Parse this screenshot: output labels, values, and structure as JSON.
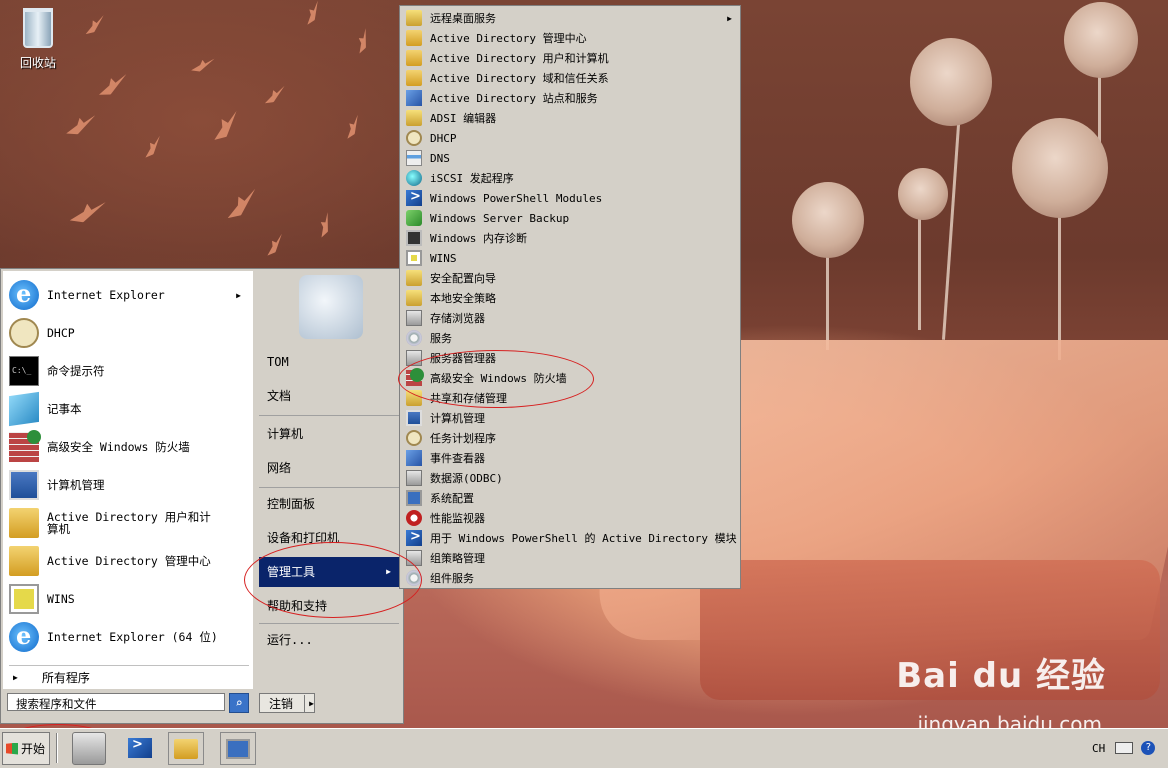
{
  "desktop": {
    "recycle_bin_label": "回收站",
    "watermark_brand": "Bai du 经验",
    "watermark_url": "jingyan.baidu.com"
  },
  "start_menu": {
    "pinned": [
      {
        "label": "Internet Explorer",
        "icon": "internet-explorer-icon",
        "has_submenu": true
      },
      {
        "label": "DHCP",
        "icon": "dhcp-icon",
        "has_submenu": false
      },
      {
        "label": "命令提示符",
        "icon": "command-prompt-icon",
        "has_submenu": false
      },
      {
        "label": "记事本",
        "icon": "notepad-icon",
        "has_submenu": false
      },
      {
        "label": "高级安全 Windows 防火墙",
        "icon": "firewall-icon",
        "has_submenu": false
      },
      {
        "label": "计算机管理",
        "icon": "computer-management-icon",
        "has_submenu": false
      },
      {
        "label": "Active Directory 用户和计算机",
        "icon": "ad-users-computers-icon",
        "has_submenu": false
      },
      {
        "label": "Active Directory 管理中心",
        "icon": "ad-admin-center-icon",
        "has_submenu": false
      },
      {
        "label": "WINS",
        "icon": "wins-icon",
        "has_submenu": false
      },
      {
        "label": "Internet Explorer (64 位)",
        "icon": "internet-explorer-icon",
        "has_submenu": false
      }
    ],
    "all_programs": "所有程序",
    "search_placeholder": "搜索程序和文件",
    "right_pane": {
      "user": "TOM",
      "documents": "文档",
      "computer": "计算机",
      "network": "网络",
      "control_panel": "控制面板",
      "devices_printers": "设备和打印机",
      "admin_tools": "管理工具",
      "help": "帮助和支持",
      "run": "运行..."
    },
    "logoff": "注销"
  },
  "admin_tools_submenu": [
    {
      "label": "远程桌面服务",
      "icon": "folder-icon",
      "has_submenu": true
    },
    {
      "label": "Active Directory 管理中心",
      "icon": "ad-admin-center-icon"
    },
    {
      "label": "Active Directory 用户和计算机",
      "icon": "ad-users-computers-icon"
    },
    {
      "label": "Active Directory 域和信任关系",
      "icon": "ad-domains-trusts-icon"
    },
    {
      "label": "Active Directory 站点和服务",
      "icon": "ad-sites-services-icon"
    },
    {
      "label": "ADSI 编辑器",
      "icon": "adsi-edit-icon"
    },
    {
      "label": "DHCP",
      "icon": "dhcp-icon"
    },
    {
      "label": "DNS",
      "icon": "dns-icon"
    },
    {
      "label": "iSCSI 发起程序",
      "icon": "iscsi-icon"
    },
    {
      "label": "Windows PowerShell Modules",
      "icon": "powershell-icon"
    },
    {
      "label": "Windows Server Backup",
      "icon": "backup-icon"
    },
    {
      "label": "Windows 内存诊断",
      "icon": "memory-diagnostic-icon"
    },
    {
      "label": "WINS",
      "icon": "wins-icon"
    },
    {
      "label": "安全配置向导",
      "icon": "security-wizard-icon"
    },
    {
      "label": "本地安全策略",
      "icon": "local-security-policy-icon"
    },
    {
      "label": "存储浏览器",
      "icon": "storage-explorer-icon"
    },
    {
      "label": "服务",
      "icon": "services-icon"
    },
    {
      "label": "服务器管理器",
      "icon": "server-manager-icon"
    },
    {
      "label": "高级安全 Windows 防火墙",
      "icon": "firewall-icon"
    },
    {
      "label": "共享和存储管理",
      "icon": "share-storage-icon"
    },
    {
      "label": "计算机管理",
      "icon": "computer-management-icon"
    },
    {
      "label": "任务计划程序",
      "icon": "task-scheduler-icon"
    },
    {
      "label": "事件查看器",
      "icon": "event-viewer-icon"
    },
    {
      "label": "数据源(ODBC)",
      "icon": "odbc-icon"
    },
    {
      "label": "系统配置",
      "icon": "system-config-icon"
    },
    {
      "label": "性能监视器",
      "icon": "performance-monitor-icon"
    },
    {
      "label": "用于 Windows PowerShell 的 Active Directory 模块",
      "icon": "powershell-icon"
    },
    {
      "label": "组策略管理",
      "icon": "group-policy-icon"
    },
    {
      "label": "组件服务",
      "icon": "component-services-icon"
    }
  ],
  "taskbar": {
    "start_label": "开始",
    "language": "CH"
  }
}
